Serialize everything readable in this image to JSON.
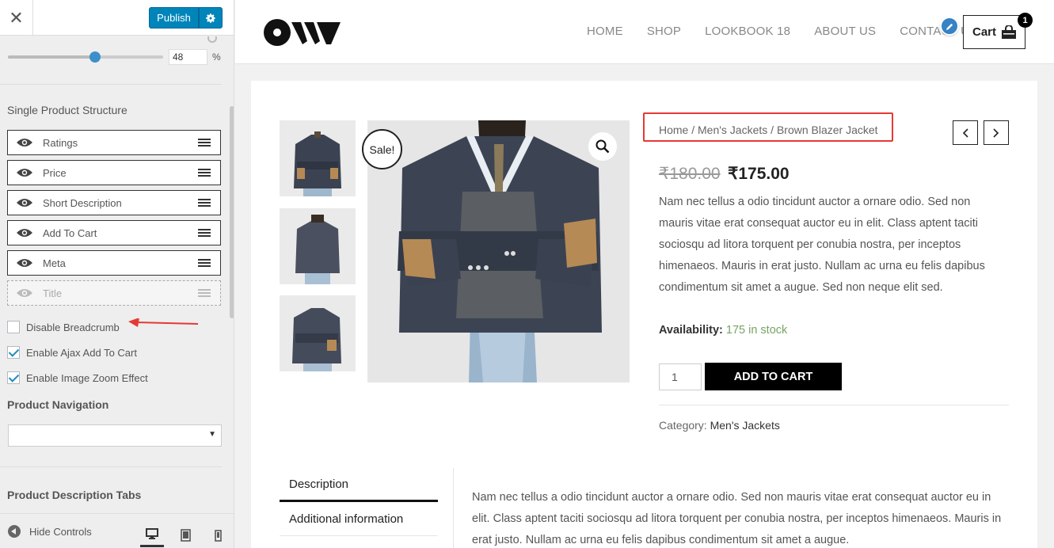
{
  "customizer": {
    "close_symbol": "✕",
    "publish_label": "Publish",
    "slider": {
      "value": "48",
      "unit": "%",
      "fraction": 0.56
    },
    "single_product_structure": {
      "heading": "Single Product Structure",
      "items": [
        {
          "label": "Ratings",
          "visible": true
        },
        {
          "label": "Price",
          "visible": true
        },
        {
          "label": "Short Description",
          "visible": true
        },
        {
          "label": "Add To Cart",
          "visible": true
        },
        {
          "label": "Meta",
          "visible": true
        },
        {
          "label": "Title",
          "visible": false
        }
      ]
    },
    "options": [
      {
        "label": "Disable Breadcrumb",
        "checked": false
      },
      {
        "label": "Enable Ajax Add To Cart",
        "checked": true
      },
      {
        "label": "Enable Image Zoom Effect",
        "checked": true
      }
    ],
    "product_navigation": {
      "heading": "Product Navigation",
      "selected": ""
    },
    "product_description_tabs": {
      "heading": "Product Description Tabs"
    },
    "footer": {
      "hide_controls_label": "Hide Controls"
    }
  },
  "site": {
    "nav": [
      "HOME",
      "SHOP",
      "LOOKBOOK 18",
      "ABOUT US",
      "CONTACT US"
    ],
    "cart": {
      "label": "Cart",
      "count": "1"
    },
    "product": {
      "breadcrumb": "Home / Men's Jackets / Brown Blazer Jacket",
      "sale_badge": "Sale!",
      "price_old": "₹180.00",
      "price_new": "₹175.00",
      "short_description": "Nam nec tellus a odio tincidunt auctor a ornare odio. Sed non mauris vitae erat consequat auctor eu in elit. Class aptent taciti sociosqu ad litora torquent per conubia nostra, per inceptos himenaeos. Mauris in erat justo. Nullam ac urna eu felis dapibus condimentum sit amet a augue. Sed non neque elit sed.",
      "availability_label": "Availability:",
      "availability_value": "175 in stock",
      "quantity": "1",
      "add_to_cart_label": "ADD TO CART",
      "category_label": "Category:",
      "category_value": "Men's Jackets"
    },
    "tabs": [
      "Description",
      "Additional information"
    ],
    "tab_content": "Nam nec tellus a odio tincidunt auctor a ornare odio. Sed non mauris vitae erat consequat auctor eu in elit. Class aptent taciti sociosqu ad litora torquent per conubia nostra, per inceptos himenaeos. Mauris in erat justo. Nullam ac urna eu felis dapibus condimentum sit amet a augue."
  },
  "colors": {
    "publish_blue": "#0085ba",
    "sale_red_outline": "#e53935",
    "in_stock_green": "#77a464"
  }
}
